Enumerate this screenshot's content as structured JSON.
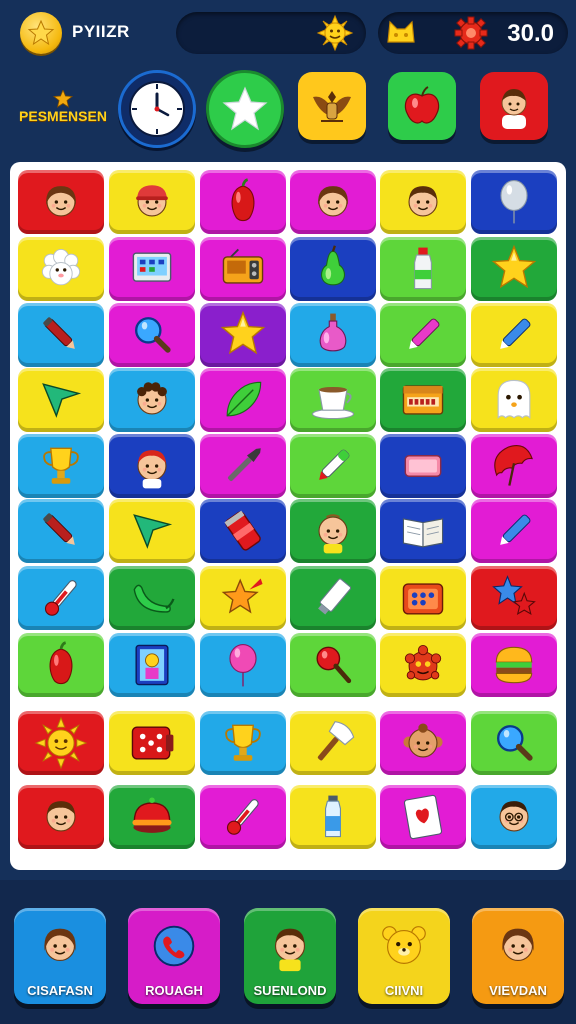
{
  "player": {
    "name": "PYIIZR",
    "avatar_icon": "gold-star-coin-icon"
  },
  "status": {
    "score": "30.0",
    "left_icon": "sun-face-icon",
    "right_icons": [
      "cat-head-icon",
      "gear-icon"
    ]
  },
  "rank": {
    "label": "PESMENSEN",
    "icon": "gold-star-icon"
  },
  "powerups": [
    {
      "name": "clock",
      "icon": "clock-icon"
    },
    {
      "name": "star",
      "icon": "star-icon"
    },
    {
      "name": "eagle",
      "icon": "eagle-emblem-icon"
    },
    {
      "name": "apple",
      "icon": "apple-icon"
    },
    {
      "name": "boy",
      "icon": "boy-avatar-icon"
    }
  ],
  "board": {
    "rows": [
      [
        {
          "c": "#e0191e",
          "i": "face-girl"
        },
        {
          "c": "#f6e21c",
          "i": "face-boy-cap"
        },
        {
          "c": "#e21cd4",
          "i": "pepper"
        },
        {
          "c": "#e21cd4",
          "i": "face-girl"
        },
        {
          "c": "#f6e21c",
          "i": "face-boy"
        },
        {
          "c": "#1b3fc0",
          "i": "balloon"
        }
      ],
      [
        {
          "c": "#f6e21c",
          "i": "sheep"
        },
        {
          "c": "#e21cd4",
          "i": "tablet"
        },
        {
          "c": "#e21cd4",
          "i": "radio"
        },
        {
          "c": "#1b3fc0",
          "i": "pear"
        },
        {
          "c": "#5ed63a",
          "i": "bottle"
        },
        {
          "c": "#22a83a",
          "i": "star"
        }
      ],
      [
        {
          "c": "#22a9e8",
          "i": "marker"
        },
        {
          "c": "#e21cd4",
          "i": "magnifier"
        },
        {
          "c": "#8a1fcc",
          "i": "star"
        },
        {
          "c": "#22a9e8",
          "i": "potion"
        },
        {
          "c": "#5ed63a",
          "i": "marker-pink"
        },
        {
          "c": "#f6e21c",
          "i": "marker-blue"
        }
      ],
      [
        {
          "c": "#f6e21c",
          "i": "arrow"
        },
        {
          "c": "#22a9e8",
          "i": "face-curly"
        },
        {
          "c": "#e21cd4",
          "i": "leaf"
        },
        {
          "c": "#5ed63a",
          "i": "cup"
        },
        {
          "c": "#22a83a",
          "i": "box"
        },
        {
          "c": "#f6e21c",
          "i": "ghost"
        }
      ],
      [
        {
          "c": "#22a9e8",
          "i": "trophy"
        },
        {
          "c": "#1b3fc0",
          "i": "face-red-hair"
        },
        {
          "c": "#e21cd4",
          "i": "brush"
        },
        {
          "c": "#5ed63a",
          "i": "marker-green"
        },
        {
          "c": "#1b3fc0",
          "i": "eraser"
        },
        {
          "c": "#e21cd4",
          "i": "umbrella"
        }
      ],
      [
        {
          "c": "#22a9e8",
          "i": "marker"
        },
        {
          "c": "#f6e21c",
          "i": "arrow"
        },
        {
          "c": "#1b3fc0",
          "i": "can"
        },
        {
          "c": "#22a83a",
          "i": "baby"
        },
        {
          "c": "#1b3fc0",
          "i": "book"
        },
        {
          "c": "#e21cd4",
          "i": "marker-blue"
        }
      ],
      [
        {
          "c": "#22a9e8",
          "i": "thermometer"
        },
        {
          "c": "#22a83a",
          "i": "chili"
        },
        {
          "c": "#f6e21c",
          "i": "star-rocket"
        },
        {
          "c": "#22a83a",
          "i": "tube"
        },
        {
          "c": "#f6e21c",
          "i": "dice-box"
        },
        {
          "c": "#e0191e",
          "i": "stars"
        }
      ],
      [
        {
          "c": "#5ed63a",
          "i": "pepper"
        },
        {
          "c": "#22a9e8",
          "i": "frame"
        },
        {
          "c": "#22a9e8",
          "i": "balloon-pink"
        },
        {
          "c": "#5ed63a",
          "i": "lollipop"
        },
        {
          "c": "#f6e21c",
          "i": "monster"
        },
        {
          "c": "#e21cd4",
          "i": "burger"
        }
      ],
      [
        {
          "c": "#e0191e",
          "i": "sun"
        },
        {
          "c": "#f6e21c",
          "i": "dice-box-red"
        },
        {
          "c": "#22a9e8",
          "i": "trophy"
        },
        {
          "c": "#f6e21c",
          "i": "hammer"
        },
        {
          "c": "#e21cd4",
          "i": "face-monkey"
        },
        {
          "c": "#5ed63a",
          "i": "magnifier"
        }
      ],
      [
        {
          "c": "#e0191e",
          "i": "face-boy"
        },
        {
          "c": "#22a83a",
          "i": "pot"
        },
        {
          "c": "#e21cd4",
          "i": "thermometer"
        },
        {
          "c": "#f6e21c",
          "i": "bottle-blue"
        },
        {
          "c": "#e21cd4",
          "i": "card"
        },
        {
          "c": "#22a9e8",
          "i": "face-glasses"
        }
      ]
    ]
  },
  "dock": [
    {
      "label": "CISAFASN",
      "color": "#1a8fe0",
      "icon": "girl-avatar-icon"
    },
    {
      "label": "ROUAGH",
      "color": "#d61cc8",
      "icon": "phone-icon"
    },
    {
      "label": "SUENLOND",
      "color": "#1fa33a",
      "icon": "boy-avatar-icon"
    },
    {
      "label": "CIIVNI",
      "color": "#f4d41c",
      "icon": "bear-icon"
    },
    {
      "label": "VIEVDAN",
      "color": "#f59a12",
      "icon": "girl-avatar-icon"
    }
  ]
}
